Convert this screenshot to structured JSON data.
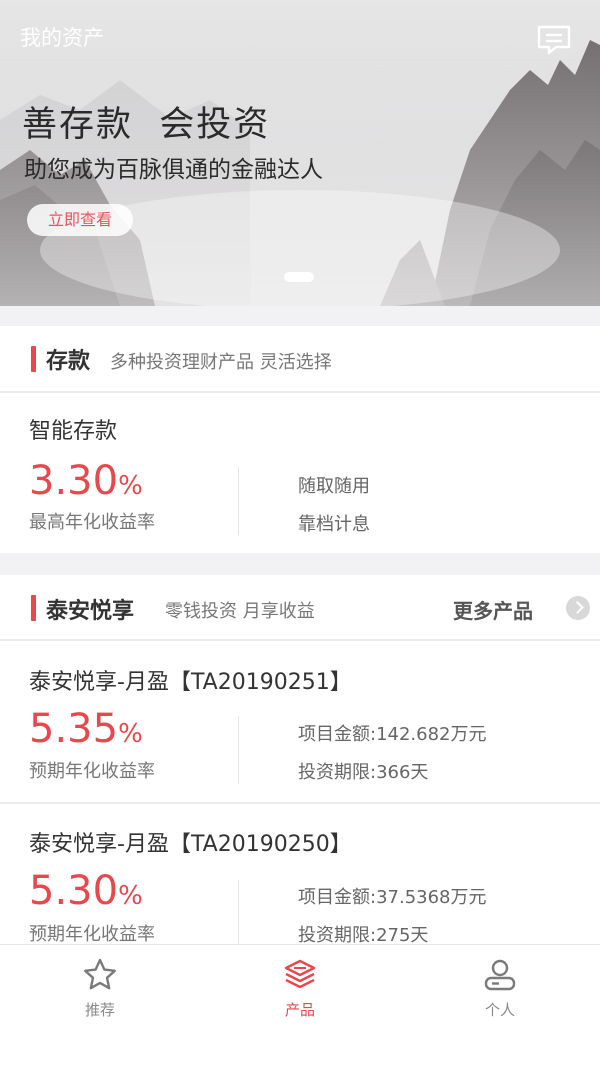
{
  "header": {
    "title": "我的资产",
    "message_icon": "message-icon"
  },
  "banner": {
    "headline": "善存款  会投资",
    "subline": "助您成为百脉俱通的金融达人",
    "cta_label": "立即查看"
  },
  "deposit_section": {
    "title": "存款",
    "description": "多种投资理财产品 灵活选择",
    "product": {
      "name": "智能存款",
      "rate_number": "3.30",
      "rate_unit": "%",
      "rate_label": "最高年化收益率",
      "feature_1": "随取随用",
      "feature_2": "靠档计息"
    }
  },
  "taian_section": {
    "title": "泰安悦享",
    "description": "零钱投资 月享收益",
    "more_label": "更多产品",
    "products": [
      {
        "name": "泰安悦享-月盈【TA20190251】",
        "rate_number": "5.35",
        "rate_unit": "%",
        "rate_label": "预期年化收益率",
        "amount": "项目金额:142.682万元",
        "term": "投资期限:366天"
      },
      {
        "name": "泰安悦享-月盈【TA20190250】",
        "rate_number": "5.30",
        "rate_unit": "%",
        "rate_label": "预期年化收益率",
        "amount": "项目金额:37.5368万元",
        "term": "投资期限:275天"
      }
    ]
  },
  "tabbar": {
    "tabs": [
      {
        "label": "推荐",
        "icon": "star-icon",
        "active": false
      },
      {
        "label": "产品",
        "icon": "layers-icon",
        "active": true
      },
      {
        "label": "个人",
        "icon": "person-icon",
        "active": false
      }
    ]
  },
  "colors": {
    "accent": "#e8474c",
    "text": "#333333",
    "muted": "#777777",
    "separator": "#f2f2f4"
  }
}
